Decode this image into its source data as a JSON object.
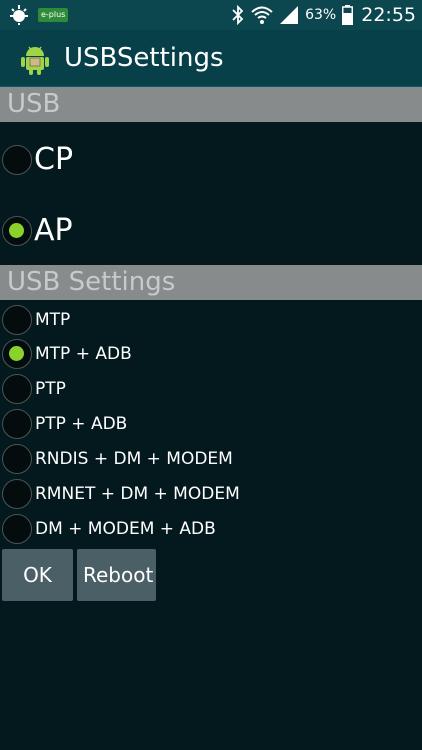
{
  "status_bar": {
    "carrier_badge": "e-plus",
    "battery": "63%",
    "time": "22:55",
    "icons": [
      "notification-icon",
      "bluetooth-icon",
      "wifi-icon",
      "signal-icon",
      "battery-icon"
    ]
  },
  "app": {
    "title": "USBSettings",
    "icon": "android-icon"
  },
  "usb_section": {
    "header": "USB",
    "options": [
      {
        "label": "CP",
        "checked": false
      },
      {
        "label": "AP",
        "checked": true
      }
    ]
  },
  "usb_settings_section": {
    "header": "USB Settings",
    "options": [
      {
        "label": "MTP",
        "checked": false
      },
      {
        "label": "MTP + ADB",
        "checked": true
      },
      {
        "label": "PTP",
        "checked": false
      },
      {
        "label": "PTP + ADB",
        "checked": false
      },
      {
        "label": "RNDIS + DM + MODEM",
        "checked": false
      },
      {
        "label": "RMNET + DM + MODEM",
        "checked": false
      },
      {
        "label": "DM + MODEM + ADB",
        "checked": false
      }
    ]
  },
  "buttons": {
    "ok": "OK",
    "reboot": "Reboot"
  },
  "colors": {
    "background": "#03191e",
    "action_bar": "#074049",
    "status_bar": "#0c464f",
    "section_header": "#878b8c",
    "radio_checked": "#8bd12c",
    "button": "#4b5f66"
  }
}
